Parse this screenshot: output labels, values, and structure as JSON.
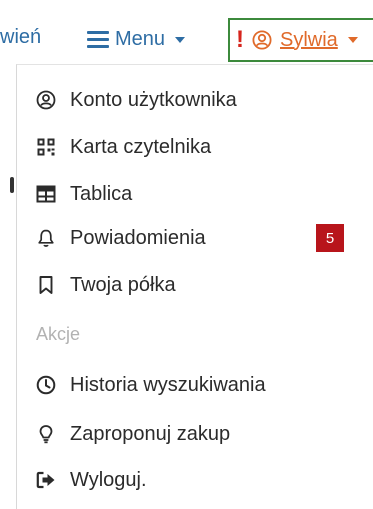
{
  "header": {
    "nav_partial": "wień",
    "menu_label": "Menu",
    "alert_mark": "!",
    "user_name": "Sylwia"
  },
  "dropdown": {
    "items": [
      {
        "label": "Konto użytkownika",
        "icon": "user-circle-icon"
      },
      {
        "label": "Karta czytelnika",
        "icon": "qr-card-icon"
      },
      {
        "label": "Tablica",
        "icon": "table-icon"
      },
      {
        "label": "Powiadomienia",
        "icon": "bell-icon",
        "badge": "5"
      },
      {
        "label": "Twoja półka",
        "icon": "bookmark-icon"
      }
    ],
    "section_title": "Akcje",
    "actions": [
      {
        "label": "Historia wyszukiwania",
        "icon": "history-clock-icon"
      },
      {
        "label": "Zaproponuj zakup",
        "icon": "lightbulb-icon"
      },
      {
        "label": "Wyloguj.",
        "icon": "sign-out-icon"
      }
    ]
  },
  "colors": {
    "link": "#2e6da4",
    "user": "#e06a2a",
    "alert": "#d6241c",
    "badge": "#b8151b",
    "border_focus": "#3c8a3c"
  }
}
